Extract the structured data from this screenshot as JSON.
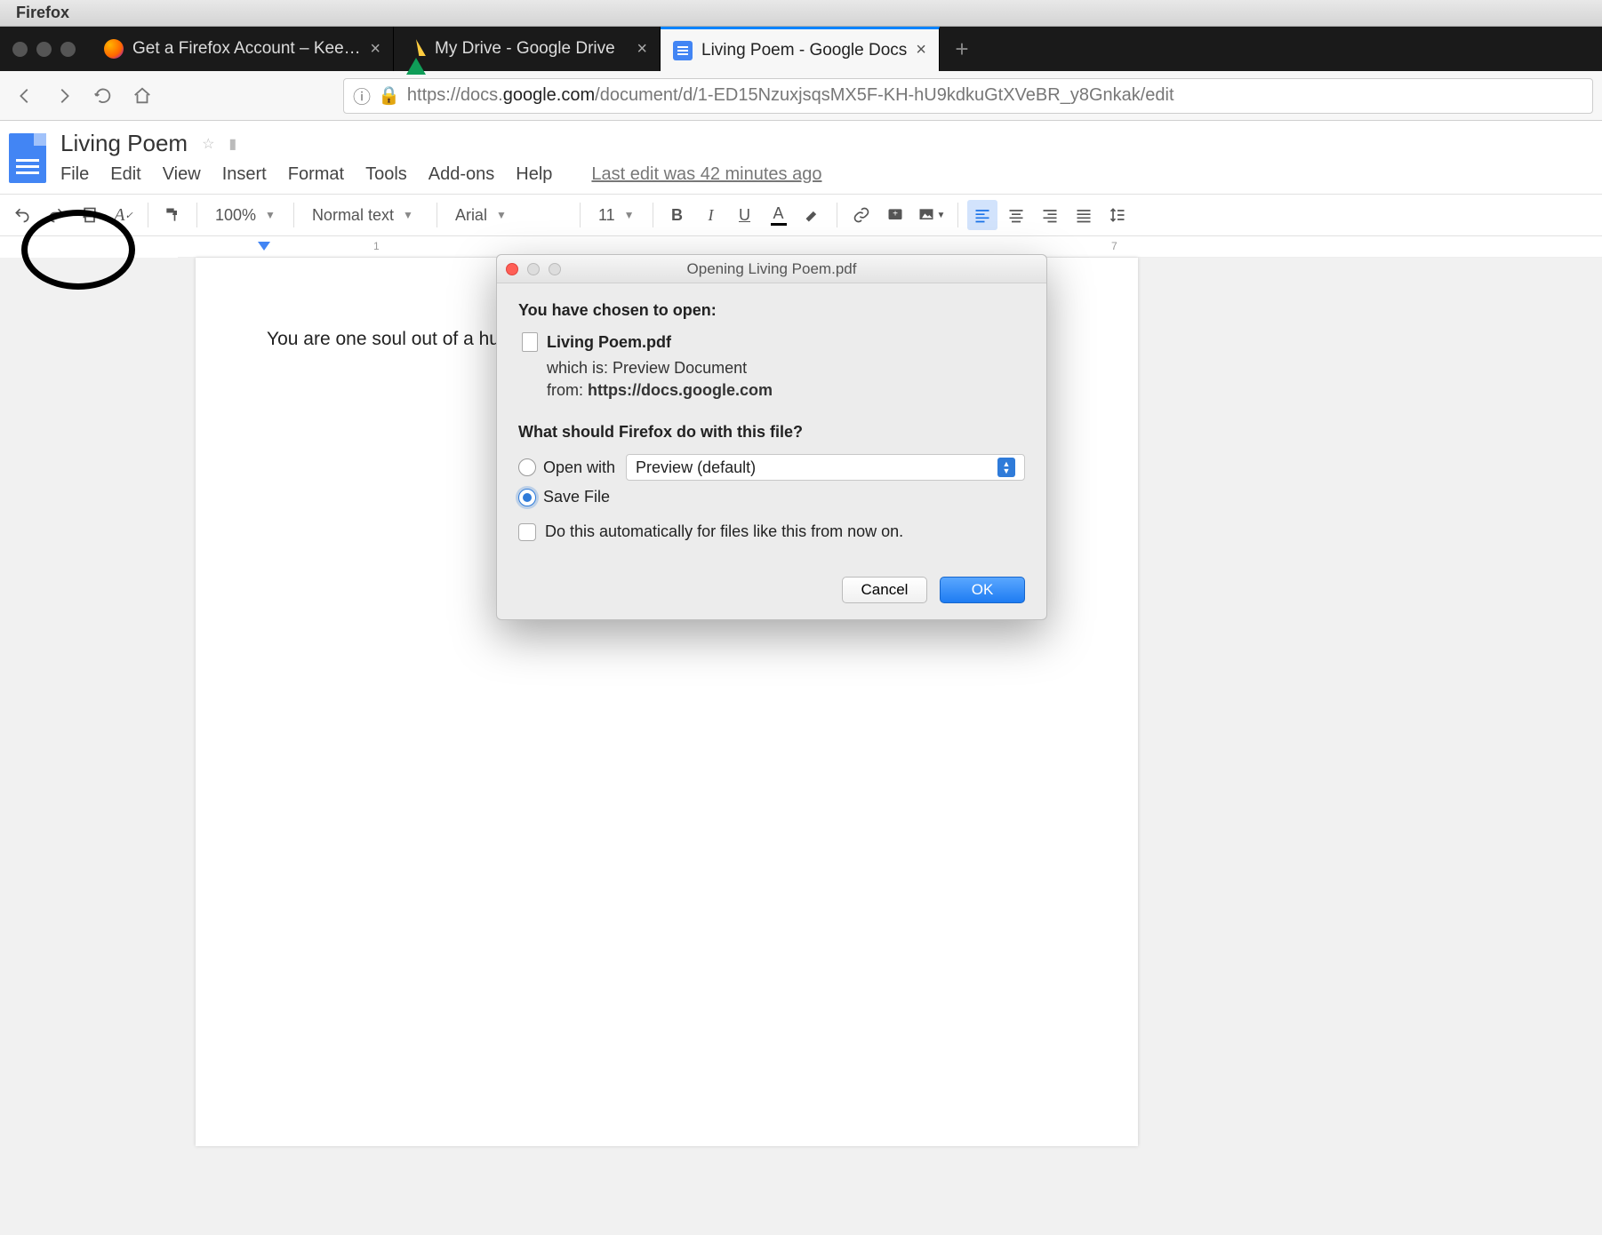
{
  "mac": {
    "app_name": "Firefox"
  },
  "tabs": [
    {
      "label": "Get a Firefox Account – Keep yo"
    },
    {
      "label": "My Drive - Google Drive"
    },
    {
      "label": "Living Poem - Google Docs"
    }
  ],
  "url": {
    "prefix": "https://docs.",
    "domain": "google.com",
    "path": "/document/d/1-ED15NzuxjsqsMX5F-KH-hU9kdkuGtXVeBR_y8Gnkak/edit"
  },
  "doc": {
    "title": "Living Poem",
    "menus": [
      "File",
      "Edit",
      "View",
      "Insert",
      "Format",
      "Tools",
      "Add-ons",
      "Help"
    ],
    "last_edit": "Last edit was 42 minutes ago"
  },
  "toolbar": {
    "zoom": "100%",
    "style": "Normal text",
    "font": "Arial",
    "size": "11"
  },
  "ruler": {
    "marks": [
      "1",
      "7"
    ]
  },
  "page": {
    "text": "You are one soul out of a hu"
  },
  "dialog": {
    "title": "Opening Living Poem.pdf",
    "chosen": "You have chosen to open:",
    "filename": "Living Poem.pdf",
    "which_is_label": "which is:",
    "which_is_value": "Preview Document",
    "from_label": "from:",
    "from_value": "https://docs.google.com",
    "question": "What should Firefox do with this file?",
    "open_with": "Open with",
    "open_app": "Preview (default)",
    "save_file": "Save File",
    "auto": "Do this automatically for files like this from now on.",
    "cancel": "Cancel",
    "ok": "OK"
  }
}
